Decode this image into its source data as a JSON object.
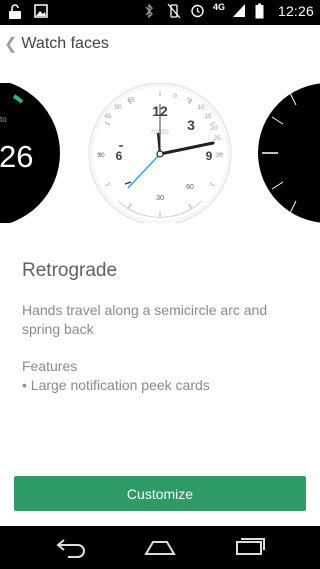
{
  "status_bar": {
    "time": "12:26",
    "network": "4G",
    "left_icons": [
      "lock-icon",
      "image-icon"
    ],
    "right_icons": [
      "bluetooth-icon",
      "vibrate-off-icon",
      "alarm-icon",
      "signal-icon",
      "battery-icon"
    ]
  },
  "header": {
    "back_glyph": "❮",
    "title": "Watch faces"
  },
  "carousel": {
    "left_face_text": "26",
    "left_face_small": "to",
    "center_face": {
      "brand": "moto",
      "hour_labels": [
        "12",
        "3",
        "6",
        "9"
      ],
      "arc_numbers": [
        "45",
        "50",
        "55",
        "0",
        "5",
        "10",
        "15",
        "20",
        "25",
        "30"
      ],
      "side_left": "30",
      "side_right": "30",
      "bottom_label": "30",
      "bottom_right_label": "60"
    }
  },
  "details": {
    "name": "Retrograde",
    "description": "Hands travel along a semicircle arc and spring back",
    "features_heading": "Features",
    "features": [
      "• Large notification peek cards"
    ]
  },
  "actions": {
    "customize_label": "Customize"
  },
  "navigation": {
    "buttons": [
      "back-icon",
      "home-icon",
      "recents-icon"
    ]
  },
  "colors": {
    "accent_green": "#2e9a66",
    "watch_dark": "#000000",
    "second_hand": "#29a3e0"
  }
}
